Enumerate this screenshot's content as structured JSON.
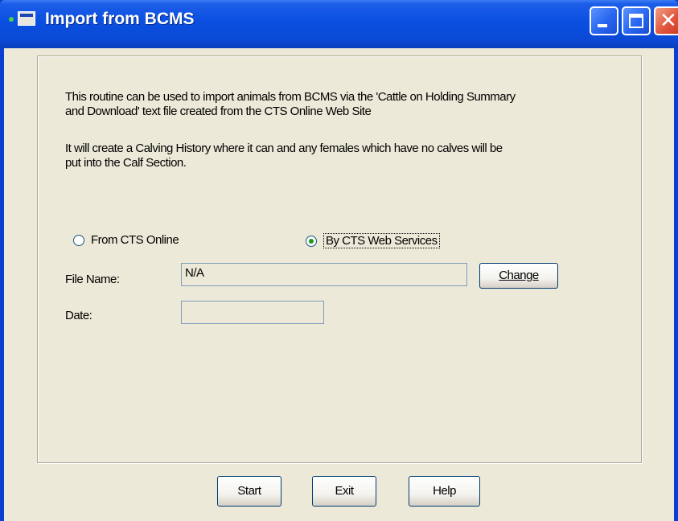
{
  "window": {
    "title": "Import from BCMS"
  },
  "description": {
    "paragraph1_line1": "This routine can be used to import animals from BCMS via the 'Cattle on Holding Summary",
    "paragraph1_line2": "and Download' text file created from the CTS Online Web Site",
    "paragraph2_line1": "It will create a Calving History where it can and any females which have no calves will be",
    "paragraph2_line2": "put into the Calf Section."
  },
  "source": {
    "option_ctsonline": "From CTS Online",
    "option_webservices": "By CTS Web Services",
    "selected": "By CTS Web Services"
  },
  "form": {
    "filename_label": "File Name:",
    "filename_value": "N/A",
    "change_button": "Change",
    "date_label": "Date:",
    "date_value": ""
  },
  "buttons": {
    "start": "Start",
    "exit": "Exit",
    "help": "Help"
  }
}
